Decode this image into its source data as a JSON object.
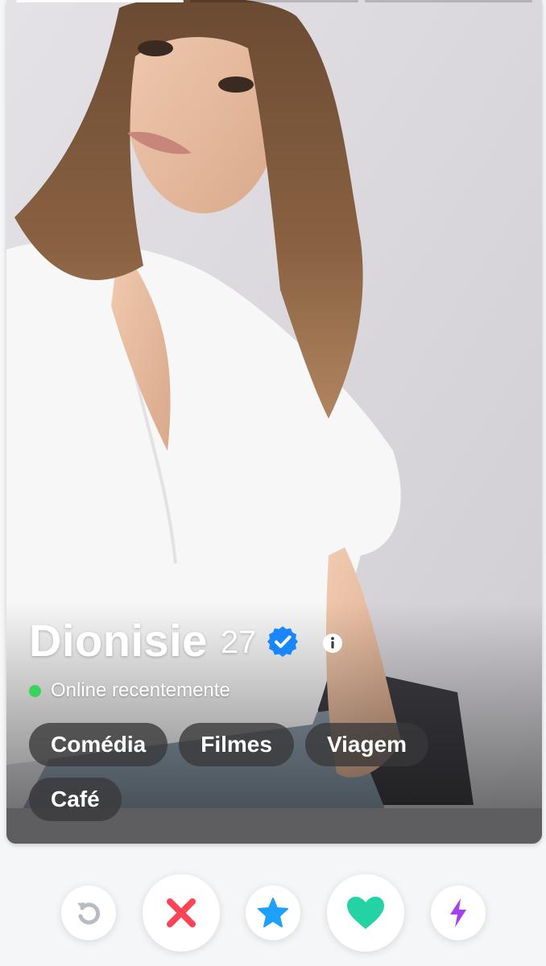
{
  "profile": {
    "name": "Dionisie",
    "age": "27",
    "status": "Online recentemente",
    "interests": [
      "Comédia",
      "Filmes",
      "Viagem",
      "Café"
    ],
    "photo_count": 3,
    "active_photo": 1
  },
  "colors": {
    "online": "#3ad35c",
    "verified": "#1786ff",
    "rewind": "#b6bcc4",
    "nope": "#ff4458",
    "super_like": "#1ea0ff",
    "like": "#23d3a4",
    "boost": "#a63ff0"
  },
  "icons": {
    "rewind": "rewind-icon",
    "nope": "close-icon",
    "super_like": "star-icon",
    "like": "heart-icon",
    "boost": "lightning-icon",
    "verified": "verified-badge-icon",
    "info": "info-icon"
  }
}
